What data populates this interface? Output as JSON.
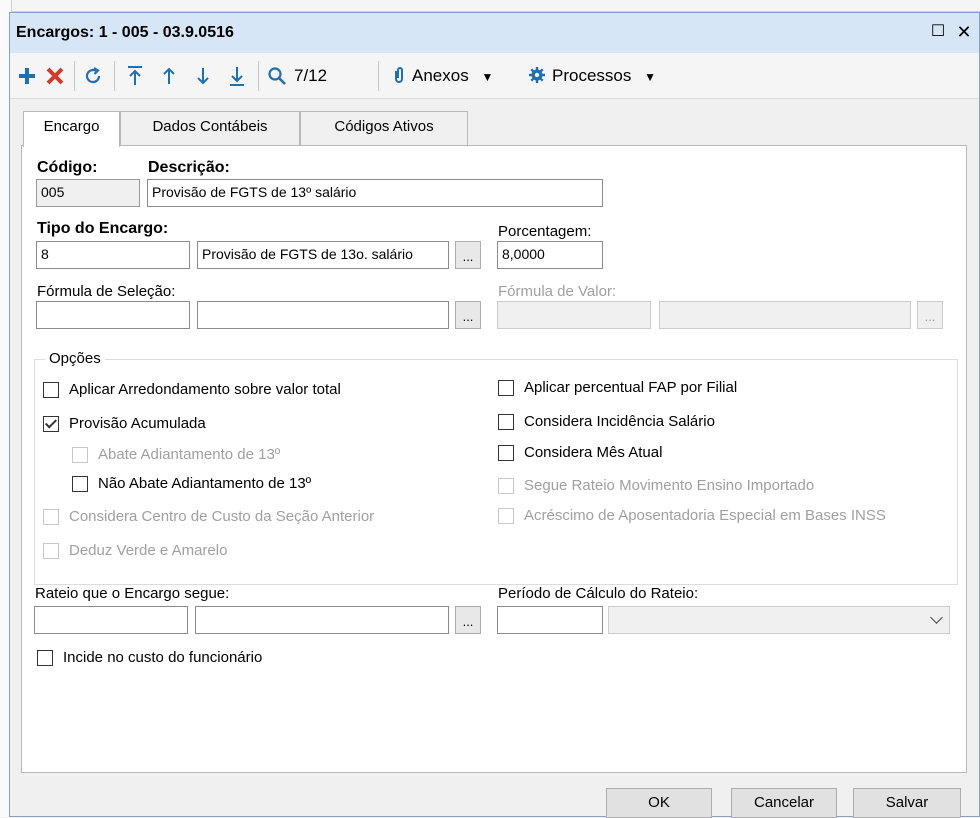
{
  "window": {
    "title": "Encargos: 1 - 005 - 03.9.0516",
    "maximize_glyph": "☐",
    "close_glyph": "✕"
  },
  "toolbar": {
    "add_icon": "plus-icon",
    "delete_icon": "x-icon",
    "refresh_icon": "refresh-icon",
    "record_position": "7/12",
    "attachments_label": "Anexos",
    "processes_label": "Processos",
    "colors": {
      "add": "#1f6fb5",
      "delete": "#d23a2b",
      "nav": "#1f6fb5"
    }
  },
  "tabs": [
    "Encargo",
    "Dados Contábeis",
    "Códigos Ativos"
  ],
  "form": {
    "codigo_label": "Código:",
    "codigo_value": "005",
    "descricao_label": "Descrição:",
    "descricao_value": "Provisão de FGTS de 13º salário",
    "tipo_label": "Tipo do Encargo:",
    "tipo_code": "8",
    "tipo_desc": "Provisão de FGTS de 13o. salário",
    "porcentagem_label": "Porcentagem:",
    "porcentagem_value": "8,0000",
    "formula_selecao_label": "Fórmula de Seleção:",
    "formula_valor_label": "Fórmula de Valor:",
    "lookup_label": "...",
    "rateio_label": "Rateio que o Encargo segue:",
    "periodo_label": "Período de Cálculo do Rateio:",
    "incide_label": "Incide no custo do funcionário"
  },
  "opcoes": {
    "title": "Opções",
    "left": [
      {
        "label": "Aplicar Arredondamento sobre valor total",
        "checked": false,
        "enabled": true
      },
      {
        "label": "Provisão Acumulada",
        "checked": true,
        "enabled": true
      },
      {
        "label": "Abate Adiantamento de 13º",
        "checked": false,
        "enabled": false
      },
      {
        "label": "Não Abate Adiantamento de 13º",
        "checked": false,
        "enabled": true
      },
      {
        "label": "Considera Centro de Custo da Seção Anterior",
        "checked": false,
        "enabled": false
      },
      {
        "label": "Deduz Verde e Amarelo",
        "checked": false,
        "enabled": false
      }
    ],
    "right": [
      {
        "label": "Aplicar percentual FAP por Filial",
        "checked": false,
        "enabled": true
      },
      {
        "label": "Considera Incidência Salário",
        "checked": false,
        "enabled": true
      },
      {
        "label": "Considera Mês Atual",
        "checked": false,
        "enabled": true
      },
      {
        "label": "Segue Rateio Movimento Ensino Importado",
        "checked": false,
        "enabled": false
      },
      {
        "label": "Acréscimo de Aposentadoria Especial em Bases INSS",
        "checked": false,
        "enabled": false
      }
    ]
  },
  "buttons": {
    "ok": "OK",
    "cancel": "Cancelar",
    "save": "Salvar"
  }
}
